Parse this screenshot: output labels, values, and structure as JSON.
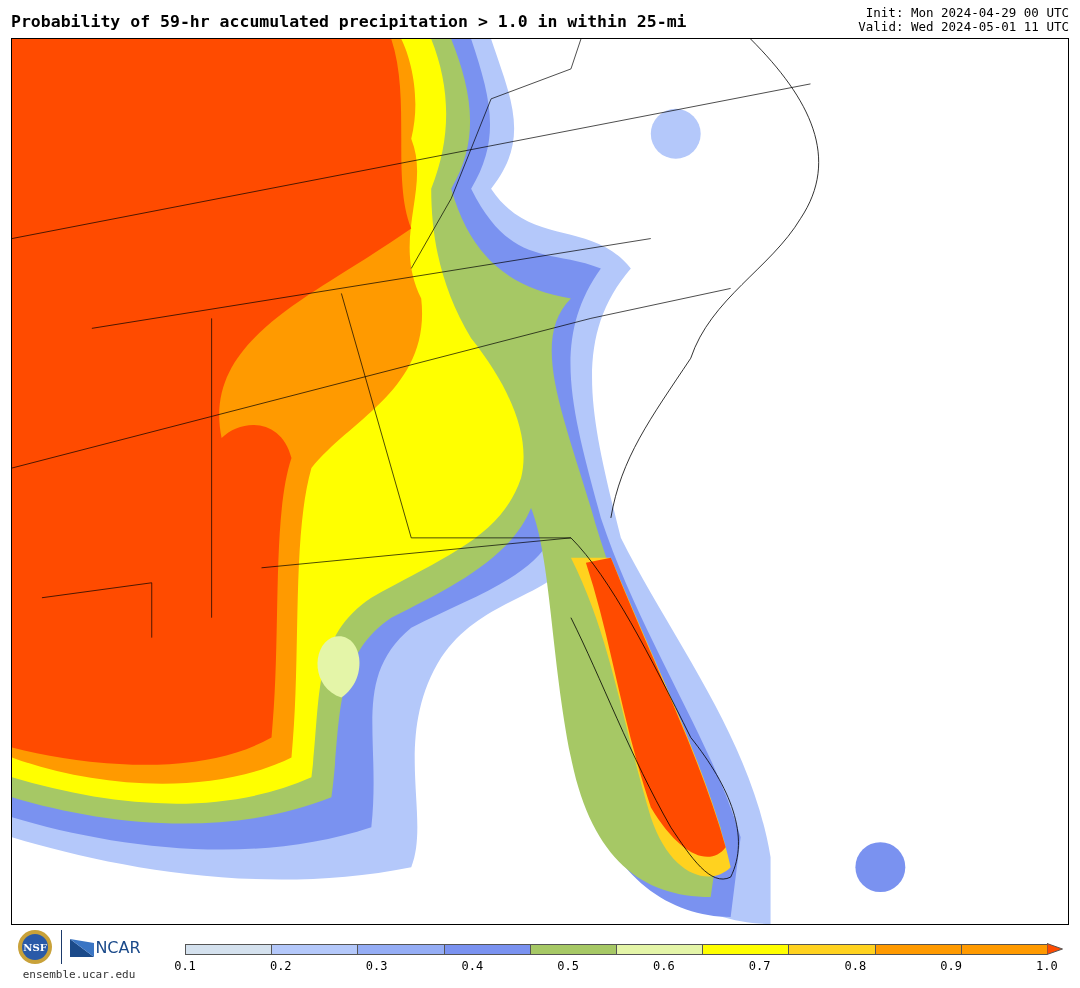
{
  "header": {
    "title": "Probability of 59-hr accumulated precipitation > 1.0 in within 25-mi",
    "init": "Init: Mon 2024-04-29 00 UTC",
    "valid": "Valid: Wed 2024-05-01 11 UTC"
  },
  "footer": {
    "nsf": "NSF",
    "ncar": "NCAR",
    "url": "ensemble.ucar.edu"
  },
  "colorbar": {
    "segments": [
      {
        "color": "#d4e1ee"
      },
      {
        "color": "#b4c8fa"
      },
      {
        "color": "#95adf5"
      },
      {
        "color": "#7a92f0"
      },
      {
        "color": "#a6c865"
      },
      {
        "color": "#e4f5a8"
      },
      {
        "color": "#ffff00"
      },
      {
        "color": "#ffd21f"
      },
      {
        "color": "#ff9a00"
      },
      {
        "color": "#ff9a00"
      },
      {
        "color": "#ff4b00",
        "kind": "arrow"
      }
    ],
    "ticks": [
      "0.1",
      "0.2",
      "0.3",
      "0.4",
      "0.5",
      "0.6",
      "0.7",
      "0.8",
      "0.9",
      "1.0"
    ]
  }
}
